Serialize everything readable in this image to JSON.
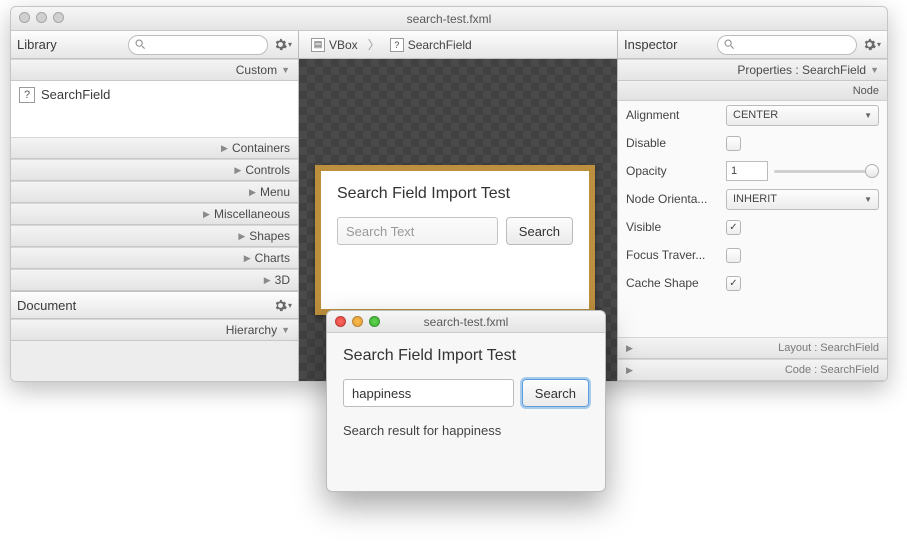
{
  "main_title": "search-test.fxml",
  "library": {
    "title": "Library",
    "custom_label": "Custom",
    "custom_item": "SearchField",
    "sections": [
      "Containers",
      "Controls",
      "Menu",
      "Miscellaneous",
      "Shapes",
      "Charts",
      "3D"
    ]
  },
  "document": {
    "title": "Document",
    "hierarchy": "Hierarchy"
  },
  "breadcrumb": {
    "item1": "VBox",
    "item2": "SearchField"
  },
  "canvas": {
    "heading": "Search Field Import Test",
    "placeholder": "Search Text",
    "button": "Search"
  },
  "inspector": {
    "title": "Inspector",
    "properties_label": "Properties : SearchField",
    "node_label": "Node",
    "rows": {
      "alignment": {
        "label": "Alignment",
        "value": "CENTER"
      },
      "disable": {
        "label": "Disable",
        "checked": false
      },
      "opacity": {
        "label": "Opacity",
        "value": "1"
      },
      "nodeorient": {
        "label": "Node Orienta...",
        "value": "INHERIT"
      },
      "visible": {
        "label": "Visible",
        "checked": true
      },
      "focus": {
        "label": "Focus Traver...",
        "checked": false
      },
      "cache": {
        "label": "Cache Shape",
        "checked": true
      }
    },
    "layout_label": "Layout : SearchField",
    "code_label": "Code : SearchField"
  },
  "preview": {
    "title": "search-test.fxml",
    "heading": "Search Field Import Test",
    "value": "happiness",
    "button": "Search",
    "result": "Search result for happiness"
  }
}
